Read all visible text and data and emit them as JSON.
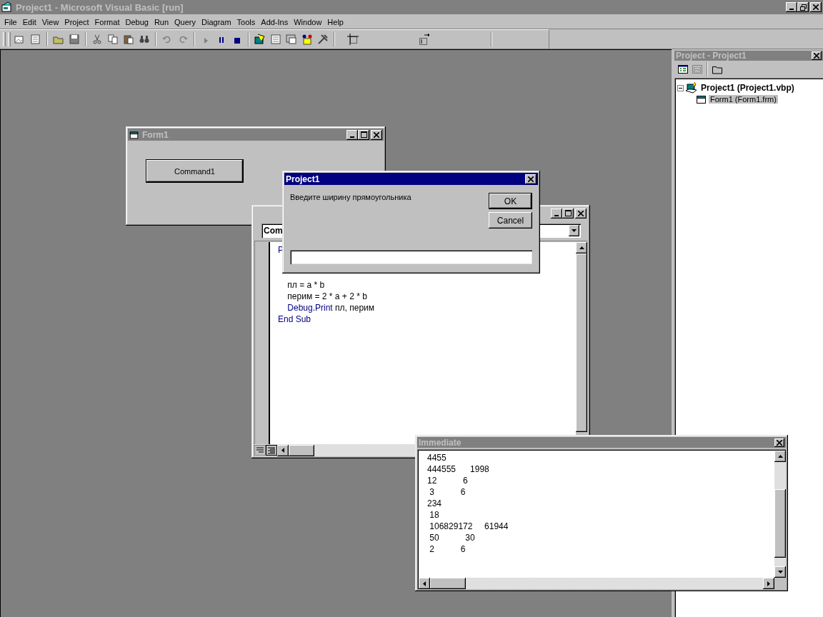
{
  "window": {
    "title": "Project1 - Microsoft Visual Basic [run]",
    "active": false
  },
  "menu": [
    "File",
    "Edit",
    "View",
    "Project",
    "Format",
    "Debug",
    "Run",
    "Query",
    "Diagram",
    "Tools",
    "Add-Ins",
    "Window",
    "Help"
  ],
  "form_window": {
    "title": "Form1",
    "active": false,
    "button": "Command1"
  },
  "code_window": {
    "object_combo": "Com",
    "top_fragment": "P",
    "lines": [
      {
        "segments": [
          {
            "text": "    пл = a * b",
            "kind": "plain"
          }
        ]
      },
      {
        "segments": [
          {
            "text": "    перим = 2 * a + 2 * b",
            "kind": "plain"
          }
        ]
      },
      {
        "segments": [
          {
            "text": "    Debug.Print",
            "kind": "keyword"
          },
          {
            "text": " пл, перим",
            "kind": "plain"
          }
        ]
      },
      {
        "segments": [
          {
            "text": "End Sub",
            "kind": "keyword"
          }
        ]
      }
    ]
  },
  "dialog": {
    "title": "Project1",
    "active": true,
    "prompt": "Введите ширину прямоугольника",
    "buttons": [
      {
        "label": "OK",
        "default": true
      },
      {
        "label": "Cancel",
        "default": false
      }
    ]
  },
  "immediate": {
    "title": "Immediate",
    "active": false,
    "lines": [
      "4455",
      "444555      1998",
      "12           6",
      " 3           6",
      "234",
      " 18",
      " 106829172     61944",
      " 50           30",
      " 2           6"
    ]
  },
  "project_panel": {
    "title": "Project - Project1",
    "active": false,
    "tree": [
      {
        "label": "Project1 (Project1.vbp)",
        "expanded": true,
        "selected": false,
        "children": [
          {
            "label": "Form1 (Form1.frm)",
            "selected": true
          }
        ]
      }
    ]
  }
}
